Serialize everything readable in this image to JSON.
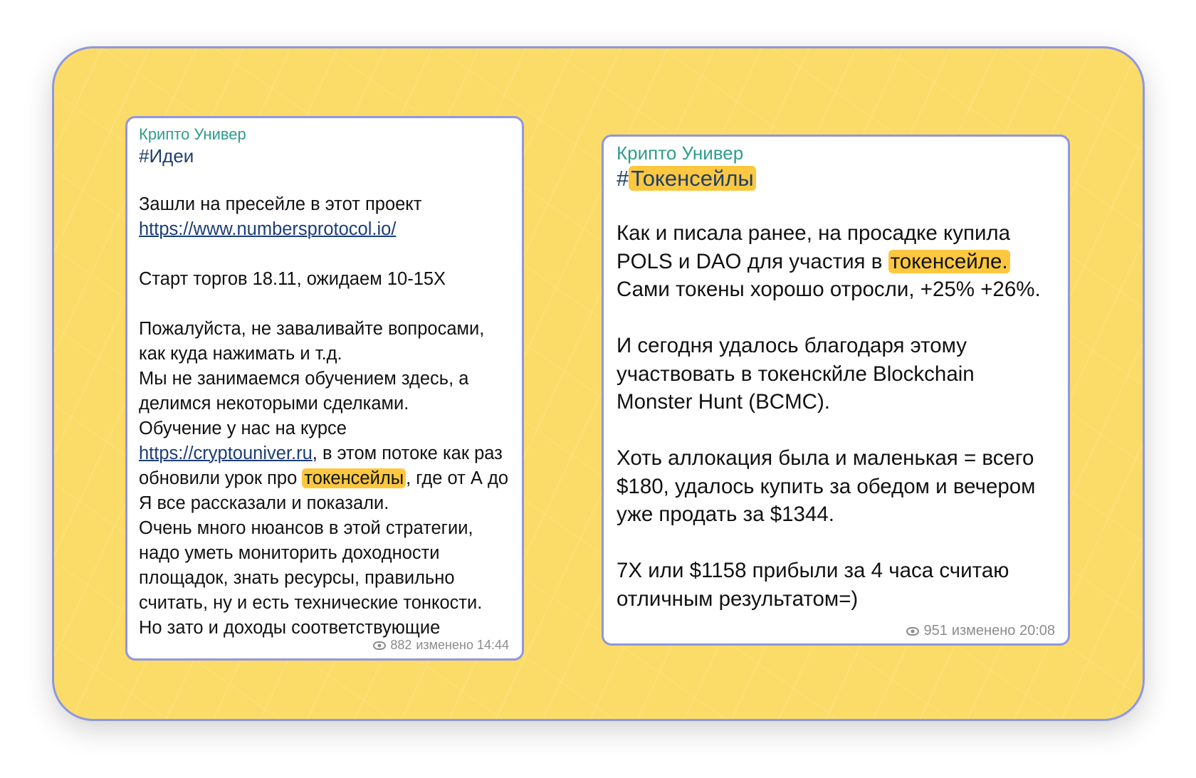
{
  "card1": {
    "channel": "Крипто Универ",
    "hashtag": "#Идеи",
    "p1_text": "Зашли на пресейле в этот проект ",
    "p1_link": "https://www.numbersprotocol.io/",
    "p2": "Старт торгов 18.11, ожидаем 10-15X",
    "p3_a": "Пожалуйста, не заваливайте вопросами, как куда нажимать и т.д.",
    "p3_b": "Мы не занимаемся обучением здесь, а делимся некоторыми сделками.",
    "p3_c": "Обучение у нас на курсе ",
    "p3_link": "https://cryptouniver.ru",
    "p3_d": ", в этом потоке как раз обновили урок про ",
    "p3_hl": "токенсейлы",
    "p3_e": ", где от А до Я все рассказали и показали.",
    "p3_f": "Очень много нюансов в этой стратегии, надо уметь мониторить доходности площадок, знать ресурсы, правильно считать, ну и есть технические тонкости.",
    "p3_g": "Но зато и доходы соответствующие",
    "views": "882",
    "edited": "изменено 14:44"
  },
  "card2": {
    "channel": "Крипто Универ",
    "hashtag_hash": "#",
    "hashtag_word": "Токенсейлы",
    "p1_a": "Как и писала ранее, на просадке купила POLS и DAO для участия в ",
    "p1_hl": "токенсейле.",
    "p1_b": " Сами токены хорошо отросли, +25% +26%.",
    "p2": "И сегодня удалось благодаря этому участвовать в токенскйле Blockchain Monster Hunt (BCMC).",
    "p3": "Хоть аллокация была и маленькая = всего $180, удалось купить за обедом и вечером уже продать за $1344.",
    "p4": "7Х или $1158 прибыли за 4 часа считаю отличным результатом=)",
    "views": "951",
    "edited": "изменено 20:08"
  }
}
